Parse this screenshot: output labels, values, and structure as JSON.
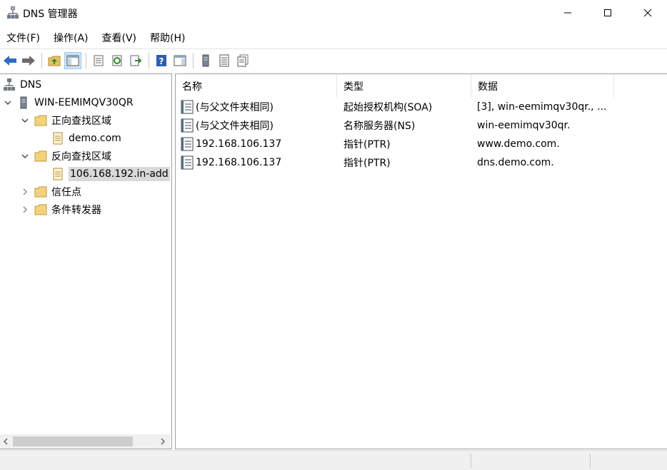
{
  "window": {
    "title": "DNS 管理器",
    "app_icon": "dns-server-icon"
  },
  "menu": [
    "文件(F)",
    "操作(A)",
    "查看(V)",
    "帮助(H)"
  ],
  "toolbar_icons": [
    "back-arrow-icon",
    "forward-arrow-icon",
    "up-folder-icon",
    "show-hide-tree-icon",
    "properties-icon",
    "refresh-icon",
    "export-list-icon",
    "help-icon",
    "action-pane-icon",
    "server-icon",
    "list-records-icon",
    "copy-records-icon"
  ],
  "tree": {
    "root": "DNS",
    "server": "WIN-EEMIMQV30QR",
    "forward_zones": "正向查找区域",
    "forward_zone_item": "demo.com",
    "reverse_zones": "反向查找区域",
    "reverse_zone_item": "106.168.192.in-add",
    "trust_points": "信任点",
    "conditional_forwarders": "条件转发器"
  },
  "list": {
    "columns": [
      "名称",
      "类型",
      "数据"
    ],
    "rows": [
      {
        "name": "(与父文件夹相同)",
        "type": "起始授权机构(SOA)",
        "data": "[3], win-eemimqv30qr., ..."
      },
      {
        "name": "(与父文件夹相同)",
        "type": "名称服务器(NS)",
        "data": "win-eemimqv30qr."
      },
      {
        "name": "192.168.106.137",
        "type": "指针(PTR)",
        "data": "www.demo.com."
      },
      {
        "name": "192.168.106.137",
        "type": "指针(PTR)",
        "data": "dns.demo.com."
      }
    ]
  },
  "colors": {
    "selection": "#d9d9d9",
    "folder": "#e8c064",
    "accent_blue": "#2b6cc4"
  }
}
